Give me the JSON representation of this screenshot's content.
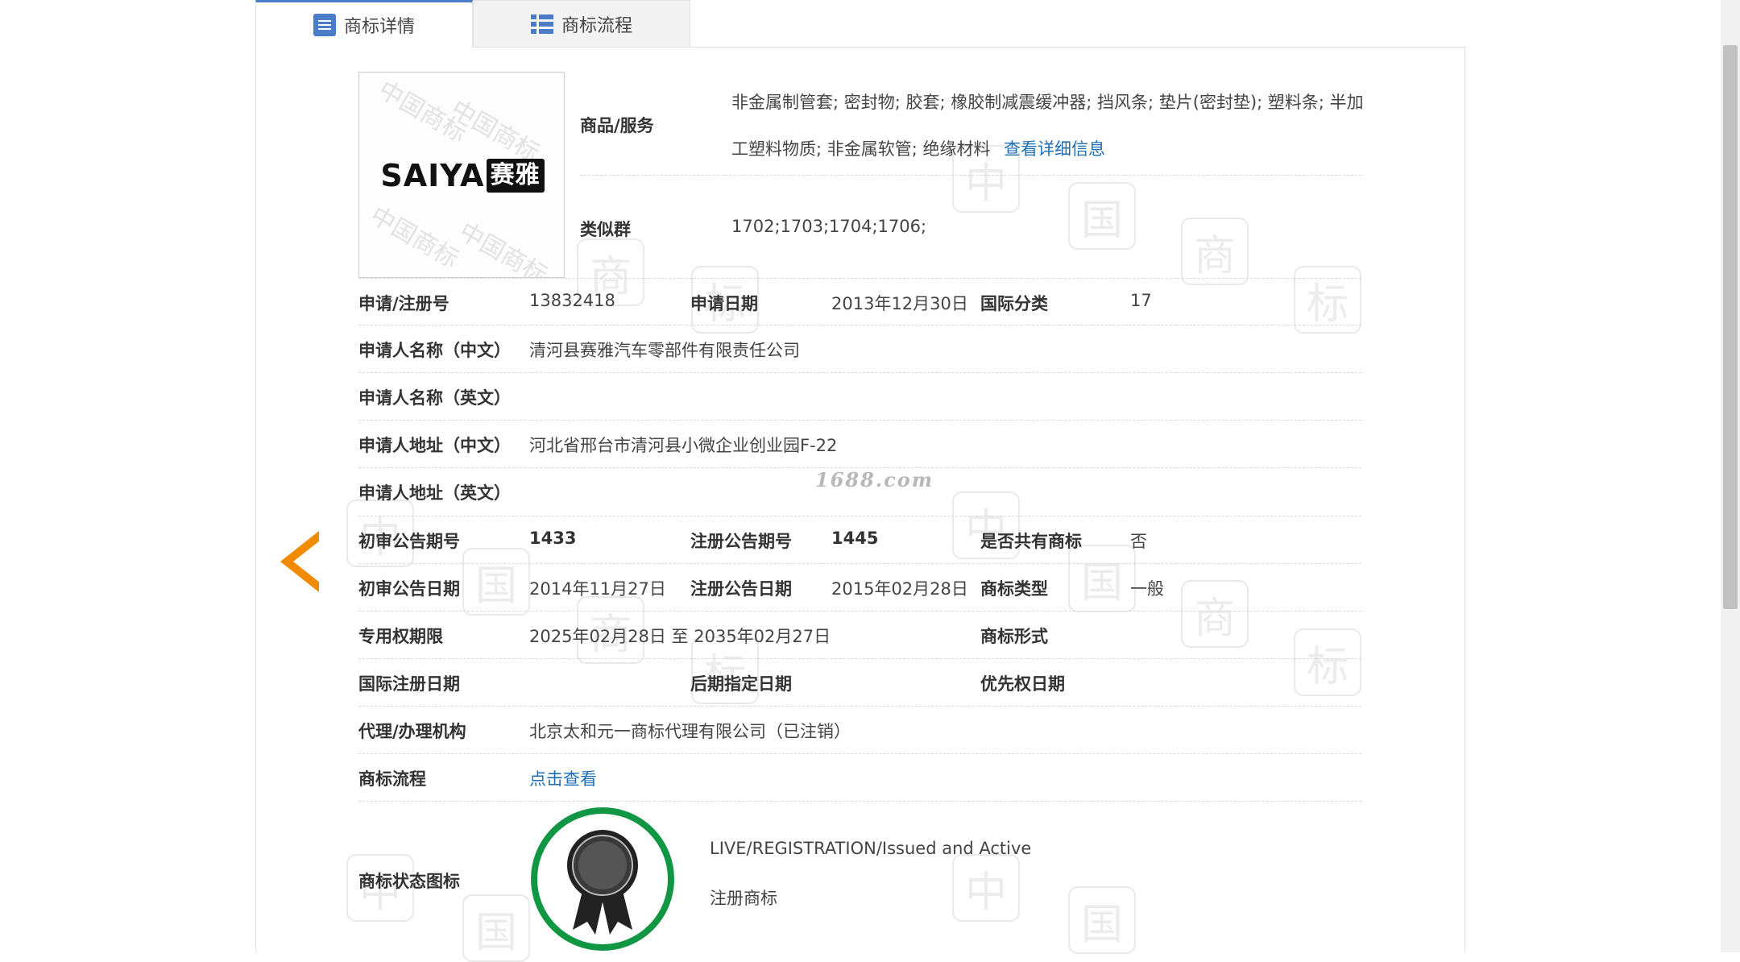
{
  "tabs": [
    {
      "label": "商标详情",
      "active": true
    },
    {
      "label": "商标流程",
      "active": false
    }
  ],
  "logo": {
    "text_en": "SAIYA",
    "text_cn": "赛雅",
    "watermark": "中国商标"
  },
  "goods": {
    "label": "商品/服务",
    "line1": "非金属制管套; 密封物; 胶套; 橡胶制减震缓冲器; 挡风条; 垫片(密封垫); 塑料条; 半加",
    "line2": "工塑料物质; 非金属软管; 绝缘材料",
    "more_link": "查看详细信息"
  },
  "similar_group": {
    "label": "类似群",
    "value": "1702;1703;1704;1706;"
  },
  "reg_no": {
    "label": "申请/注册号",
    "value": "13832418"
  },
  "apply_date": {
    "label": "申请日期",
    "value": "2013年12月30日"
  },
  "intl_class": {
    "label": "国际分类",
    "value": "17"
  },
  "applicant_cn": {
    "label": "申请人名称（中文）",
    "value": "清河县赛雅汽车零部件有限责任公司"
  },
  "applicant_en": {
    "label": "申请人名称（英文）",
    "value": ""
  },
  "address_cn": {
    "label": "申请人地址（中文）",
    "value": "河北省邢台市清河县小微企业创业园F-22"
  },
  "address_en": {
    "label": "申请人地址（英文）",
    "value": ""
  },
  "site_watermark": "1688.com",
  "prelim_issue": {
    "label": "初审公告期号",
    "value": "1433"
  },
  "reg_issue": {
    "label": "注册公告期号",
    "value": "1445"
  },
  "shared_mark": {
    "label": "是否共有商标",
    "value": "否"
  },
  "prelim_date": {
    "label": "初审公告日期",
    "value": "2014年11月27日"
  },
  "reg_date": {
    "label": "注册公告日期",
    "value": "2015年02月28日"
  },
  "mark_type": {
    "label": "商标类型",
    "value": "一般"
  },
  "exclusive_period": {
    "label": "专用权期限",
    "value": "2025年02月28日 至 2035年02月27日"
  },
  "mark_form": {
    "label": "商标形式",
    "value": ""
  },
  "intl_reg_date": {
    "label": "国际注册日期",
    "value": ""
  },
  "later_date": {
    "label": "后期指定日期",
    "value": ""
  },
  "priority_date": {
    "label": "优先权日期",
    "value": ""
  },
  "agent": {
    "label": "代理/办理机构",
    "value": "北京太和元一商标代理有限公司（已注销）"
  },
  "process": {
    "label": "商标流程",
    "link": "点击查看"
  },
  "status": {
    "label": "商标状态图标",
    "en": "LIVE/REGISTRATION/Issued and Active",
    "cn": "注册商标"
  },
  "colors": {
    "accent": "#4a7cc9",
    "link": "#1f6fb5",
    "arrow": "#f28a00",
    "seal": "#119644"
  }
}
